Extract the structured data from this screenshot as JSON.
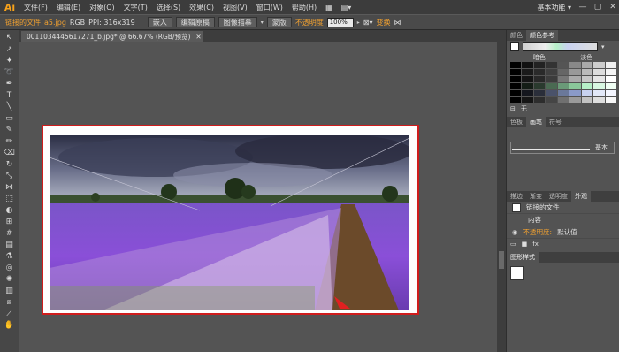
{
  "menubar": {
    "logo": "Ai",
    "items": [
      "文件(F)",
      "编辑(E)",
      "对象(O)",
      "文字(T)",
      "选择(S)",
      "效果(C)",
      "视图(V)",
      "窗口(W)",
      "帮助(H)"
    ],
    "workspace": "基本功能",
    "workspace_arrow": "▾",
    "minimize": "—",
    "maximize": "▢",
    "close": "✕"
  },
  "control_bar": {
    "linked_file": "链接的文件",
    "filename": "a5.jpg",
    "color_mode": "RGB",
    "ppi": "PPI: 316x319",
    "embed_button": "嵌入",
    "edit_original_button": "编辑原稿",
    "image_trace_button": "图像描摹",
    "mask_button": "蒙版",
    "opacity_label": "不透明度",
    "opacity_value": "100%",
    "transform_label": "变换"
  },
  "document_tab": {
    "title": "0011034445617271_b.jpg* @ 66.67% (RGB/预览)",
    "close": "✕"
  },
  "panels": {
    "swatch_tabs": [
      "颜色",
      "颜色参考"
    ],
    "swatch_labels": [
      "暗色",
      "淡色"
    ],
    "swatch_none": "无",
    "brush_tabs": [
      "色板",
      "画笔",
      "符号"
    ],
    "brush_name": "基本",
    "appearance_tabs": [
      "描边",
      "渐变",
      "透明度",
      "外观"
    ],
    "appearance_title": "链接的文件",
    "appearance_content": "内容",
    "appearance_opacity_label": "不透明度:",
    "appearance_opacity_value": "默认值",
    "graphic_styles_tab": "图形样式"
  },
  "colors": {
    "accent_orange": "#f0a030",
    "artboard_border": "#d01d1d",
    "ui_dark": "#3c3c3c",
    "ui_mid": "#535353"
  }
}
